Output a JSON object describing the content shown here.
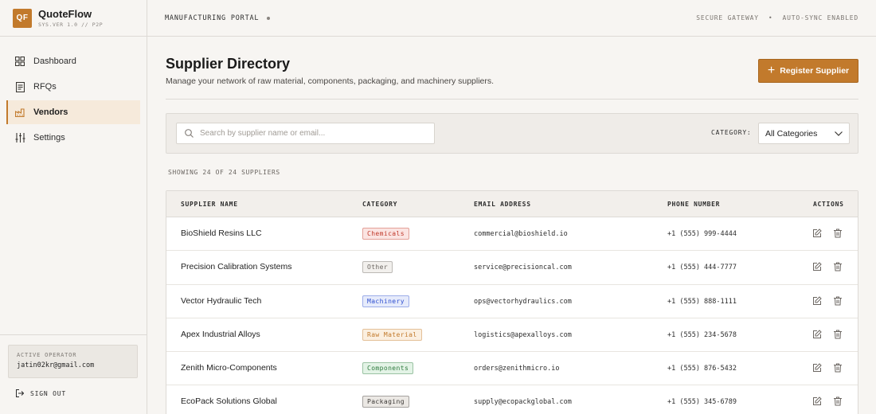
{
  "brand": {
    "logo": "QF",
    "name": "QuoteFlow",
    "version": "SYS.VER 1.0 // P2P"
  },
  "nav": [
    {
      "label": "Dashboard",
      "icon": "grid-icon",
      "active": false
    },
    {
      "label": "RFQs",
      "icon": "document-icon",
      "active": false
    },
    {
      "label": "Vendors",
      "icon": "factory-icon",
      "active": true
    },
    {
      "label": "Settings",
      "icon": "sliders-icon",
      "active": false
    }
  ],
  "operator": {
    "label": "ACTIVE OPERATOR",
    "email": "jatin02kr@gmail.com"
  },
  "signout_label": "SIGN OUT",
  "topbar": {
    "portal": "MANUFACTURING PORTAL",
    "gateway": "SECURE GATEWAY",
    "separator": "•",
    "sync": "AUTO-SYNC ENABLED"
  },
  "page": {
    "title": "Supplier Directory",
    "subtitle": "Manage your network of raw material, components, packaging, and machinery suppliers.",
    "register_label": "Register Supplier"
  },
  "filters": {
    "search_placeholder": "Search by supplier name or email...",
    "category_label": "CATEGORY:",
    "category_value": "All Categories"
  },
  "showing": "SHOWING 24 OF 24 SUPPLIERS",
  "table": {
    "headers": [
      "SUPPLIER NAME",
      "CATEGORY",
      "EMAIL ADDRESS",
      "PHONE NUMBER",
      "ACTIONS"
    ],
    "rows": [
      {
        "name": "BioShield Resins LLC",
        "category": "Chemicals",
        "email": "commercial@bioshield.io",
        "phone": "+1 (555) 999-4444"
      },
      {
        "name": "Precision Calibration Systems",
        "category": "Other",
        "email": "service@precisioncal.com",
        "phone": "+1 (555) 444-7777"
      },
      {
        "name": "Vector Hydraulic Tech",
        "category": "Machinery",
        "email": "ops@vectorhydraulics.com",
        "phone": "+1 (555) 888-1111"
      },
      {
        "name": "Apex Industrial Alloys",
        "category": "Raw Material",
        "email": "logistics@apexalloys.com",
        "phone": "+1 (555) 234-5678"
      },
      {
        "name": "Zenith Micro-Components",
        "category": "Components",
        "email": "orders@zenithmicro.io",
        "phone": "+1 (555) 876-5432"
      },
      {
        "name": "EcoPack Solutions Global",
        "category": "Packaging",
        "email": "supply@ecopackglobal.com",
        "phone": "+1 (555) 345-6789"
      }
    ]
  },
  "colors": {
    "accent": "#c27a2c",
    "badge_chemicals": "#c0392b",
    "badge_other": "#6b6661",
    "badge_machinery": "#2f4fd0",
    "badge_raw_material": "#c27a2c",
    "badge_components": "#2f7a3e",
    "badge_packaging": "#3d3a37"
  }
}
